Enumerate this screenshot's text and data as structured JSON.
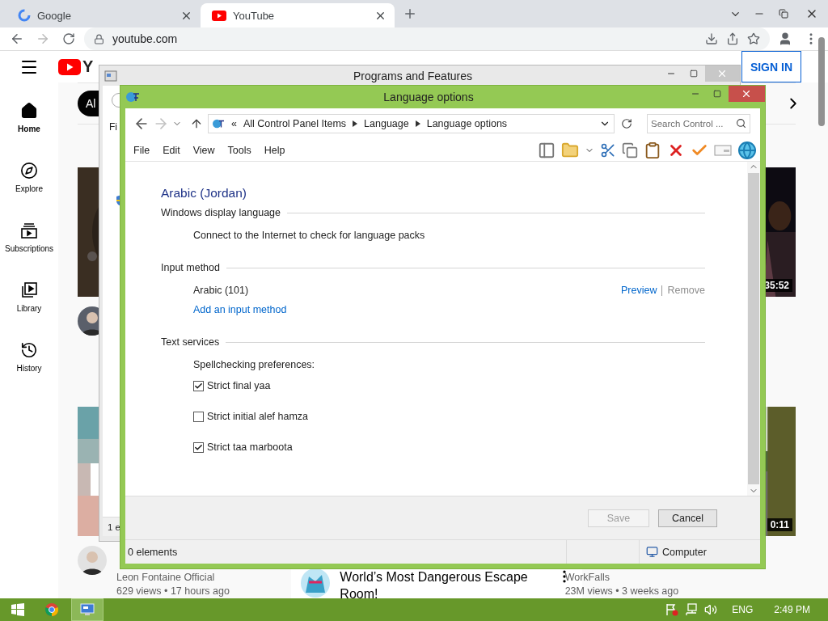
{
  "browser": {
    "tabs": [
      {
        "title": "Google",
        "kind": "google",
        "selected": false
      },
      {
        "title": "YouTube",
        "kind": "youtube",
        "selected": true
      }
    ],
    "address": "youtube.com"
  },
  "youtube": {
    "logo_text": "Y",
    "sign_in": "SIGN IN",
    "chip": "Al",
    "sidebar": [
      {
        "label": "Home",
        "kind": "home",
        "selected": true
      },
      {
        "label": "Explore",
        "kind": "explore",
        "selected": false
      },
      {
        "label": "Subscriptions",
        "kind": "subscriptions",
        "selected": false
      },
      {
        "label": "Library",
        "kind": "library",
        "selected": false
      },
      {
        "label": "History",
        "kind": "history",
        "selected": false
      }
    ],
    "rows": [
      {
        "left": {
          "avatar": true
        },
        "right": {
          "duration": "35:52"
        }
      },
      {
        "left": {
          "avatar": true,
          "channel": "Leon Fontaine Official",
          "stats": "629 views • 17 hours ago"
        },
        "middle": {
          "avatar": true,
          "title": "World’s Most Dangerous Escape Room!"
        },
        "right": {
          "duration": "0:11",
          "channel": "WorkFalls",
          "stats": "23M views • 3 weeks ago"
        }
      }
    ]
  },
  "programs_window": {
    "title": "Programs and Features",
    "menu_fragment": "Fi",
    "status_fragment": "1 e"
  },
  "language_window": {
    "title": "Language options",
    "overflow_mark": "«",
    "breadcrumb": [
      "All Control Panel Items",
      "Language",
      "Language options"
    ],
    "search_placeholder": "Search Control ...",
    "menu": [
      "File",
      "Edit",
      "View",
      "Tools",
      "Help"
    ],
    "heading": "Arabic (Jordan)",
    "sections": [
      {
        "title": "Windows display language",
        "items": [
          {
            "kind": "text",
            "text": "Connect to the Internet to check for language packs"
          }
        ]
      },
      {
        "title": "Input method",
        "items": [
          {
            "kind": "method",
            "text": "Arabic (101)",
            "actions": [
              {
                "label": "Preview",
                "disabled": false
              },
              {
                "label": "Remove",
                "disabled": true
              }
            ]
          },
          {
            "kind": "link",
            "text": "Add an input method"
          }
        ]
      },
      {
        "title": "Text services",
        "items": [
          {
            "kind": "text",
            "text": "Spellchecking preferences:"
          },
          {
            "kind": "checkbox",
            "text": "Strict final yaa",
            "checked": true
          },
          {
            "kind": "checkbox",
            "text": "Strict initial alef hamza",
            "checked": false
          },
          {
            "kind": "checkbox",
            "text": "Strict taa marboota",
            "checked": true
          }
        ]
      }
    ],
    "buttons": [
      {
        "label": "Save",
        "disabled": true
      },
      {
        "label": "Cancel",
        "disabled": false
      }
    ],
    "status": {
      "count": "0 elements",
      "location": "Computer"
    }
  },
  "taskbar": {
    "apps": [
      {
        "kind": "chrome",
        "active": false
      },
      {
        "kind": "control-panel",
        "active": true
      }
    ],
    "language": "ENG",
    "time": "2:49 PM"
  }
}
